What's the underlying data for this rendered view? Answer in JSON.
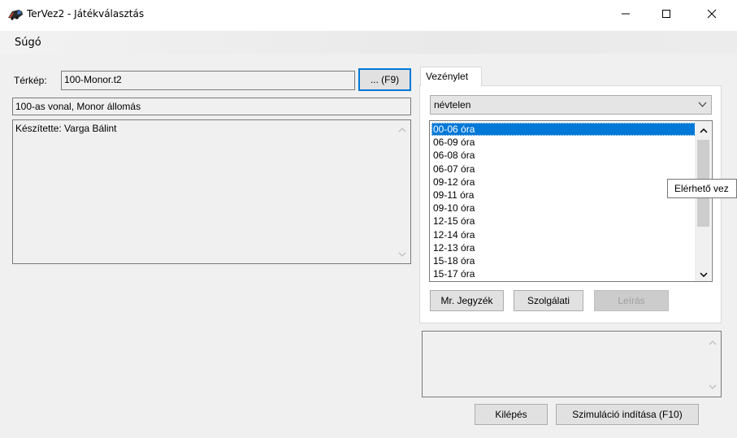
{
  "window": {
    "title": "TerVez2 - Játékválasztás",
    "icon": "locomotive-icon"
  },
  "menu": {
    "items": [
      "Súgó"
    ]
  },
  "map": {
    "label": "Térkép:",
    "value": "100-Monor.t2",
    "browse_label": "... (F9)",
    "description": "100-as vonal, Monor állomás",
    "author_text": "Készítette: Varga Bálint"
  },
  "vezenylet": {
    "tab_label": "Vezénylet",
    "selected": "névtelen",
    "schedules": [
      "00-06 óra",
      "06-09 óra",
      "06-08 óra",
      "06-07 óra",
      "09-12 óra",
      "09-11 óra",
      "09-10 óra",
      "12-15 óra",
      "12-14 óra",
      "12-13 óra",
      "15-18 óra",
      "15-17 óra"
    ],
    "selected_index": 0,
    "buttons": {
      "jegyzek": "Mr. Jegyzék",
      "szolgalati": "Szolgálati",
      "leiras": "Leírás"
    }
  },
  "tooltip": "Elérhető vez",
  "footer": {
    "exit_label": "Kilépés",
    "start_label": "Szimuláció indítása (F10)"
  }
}
